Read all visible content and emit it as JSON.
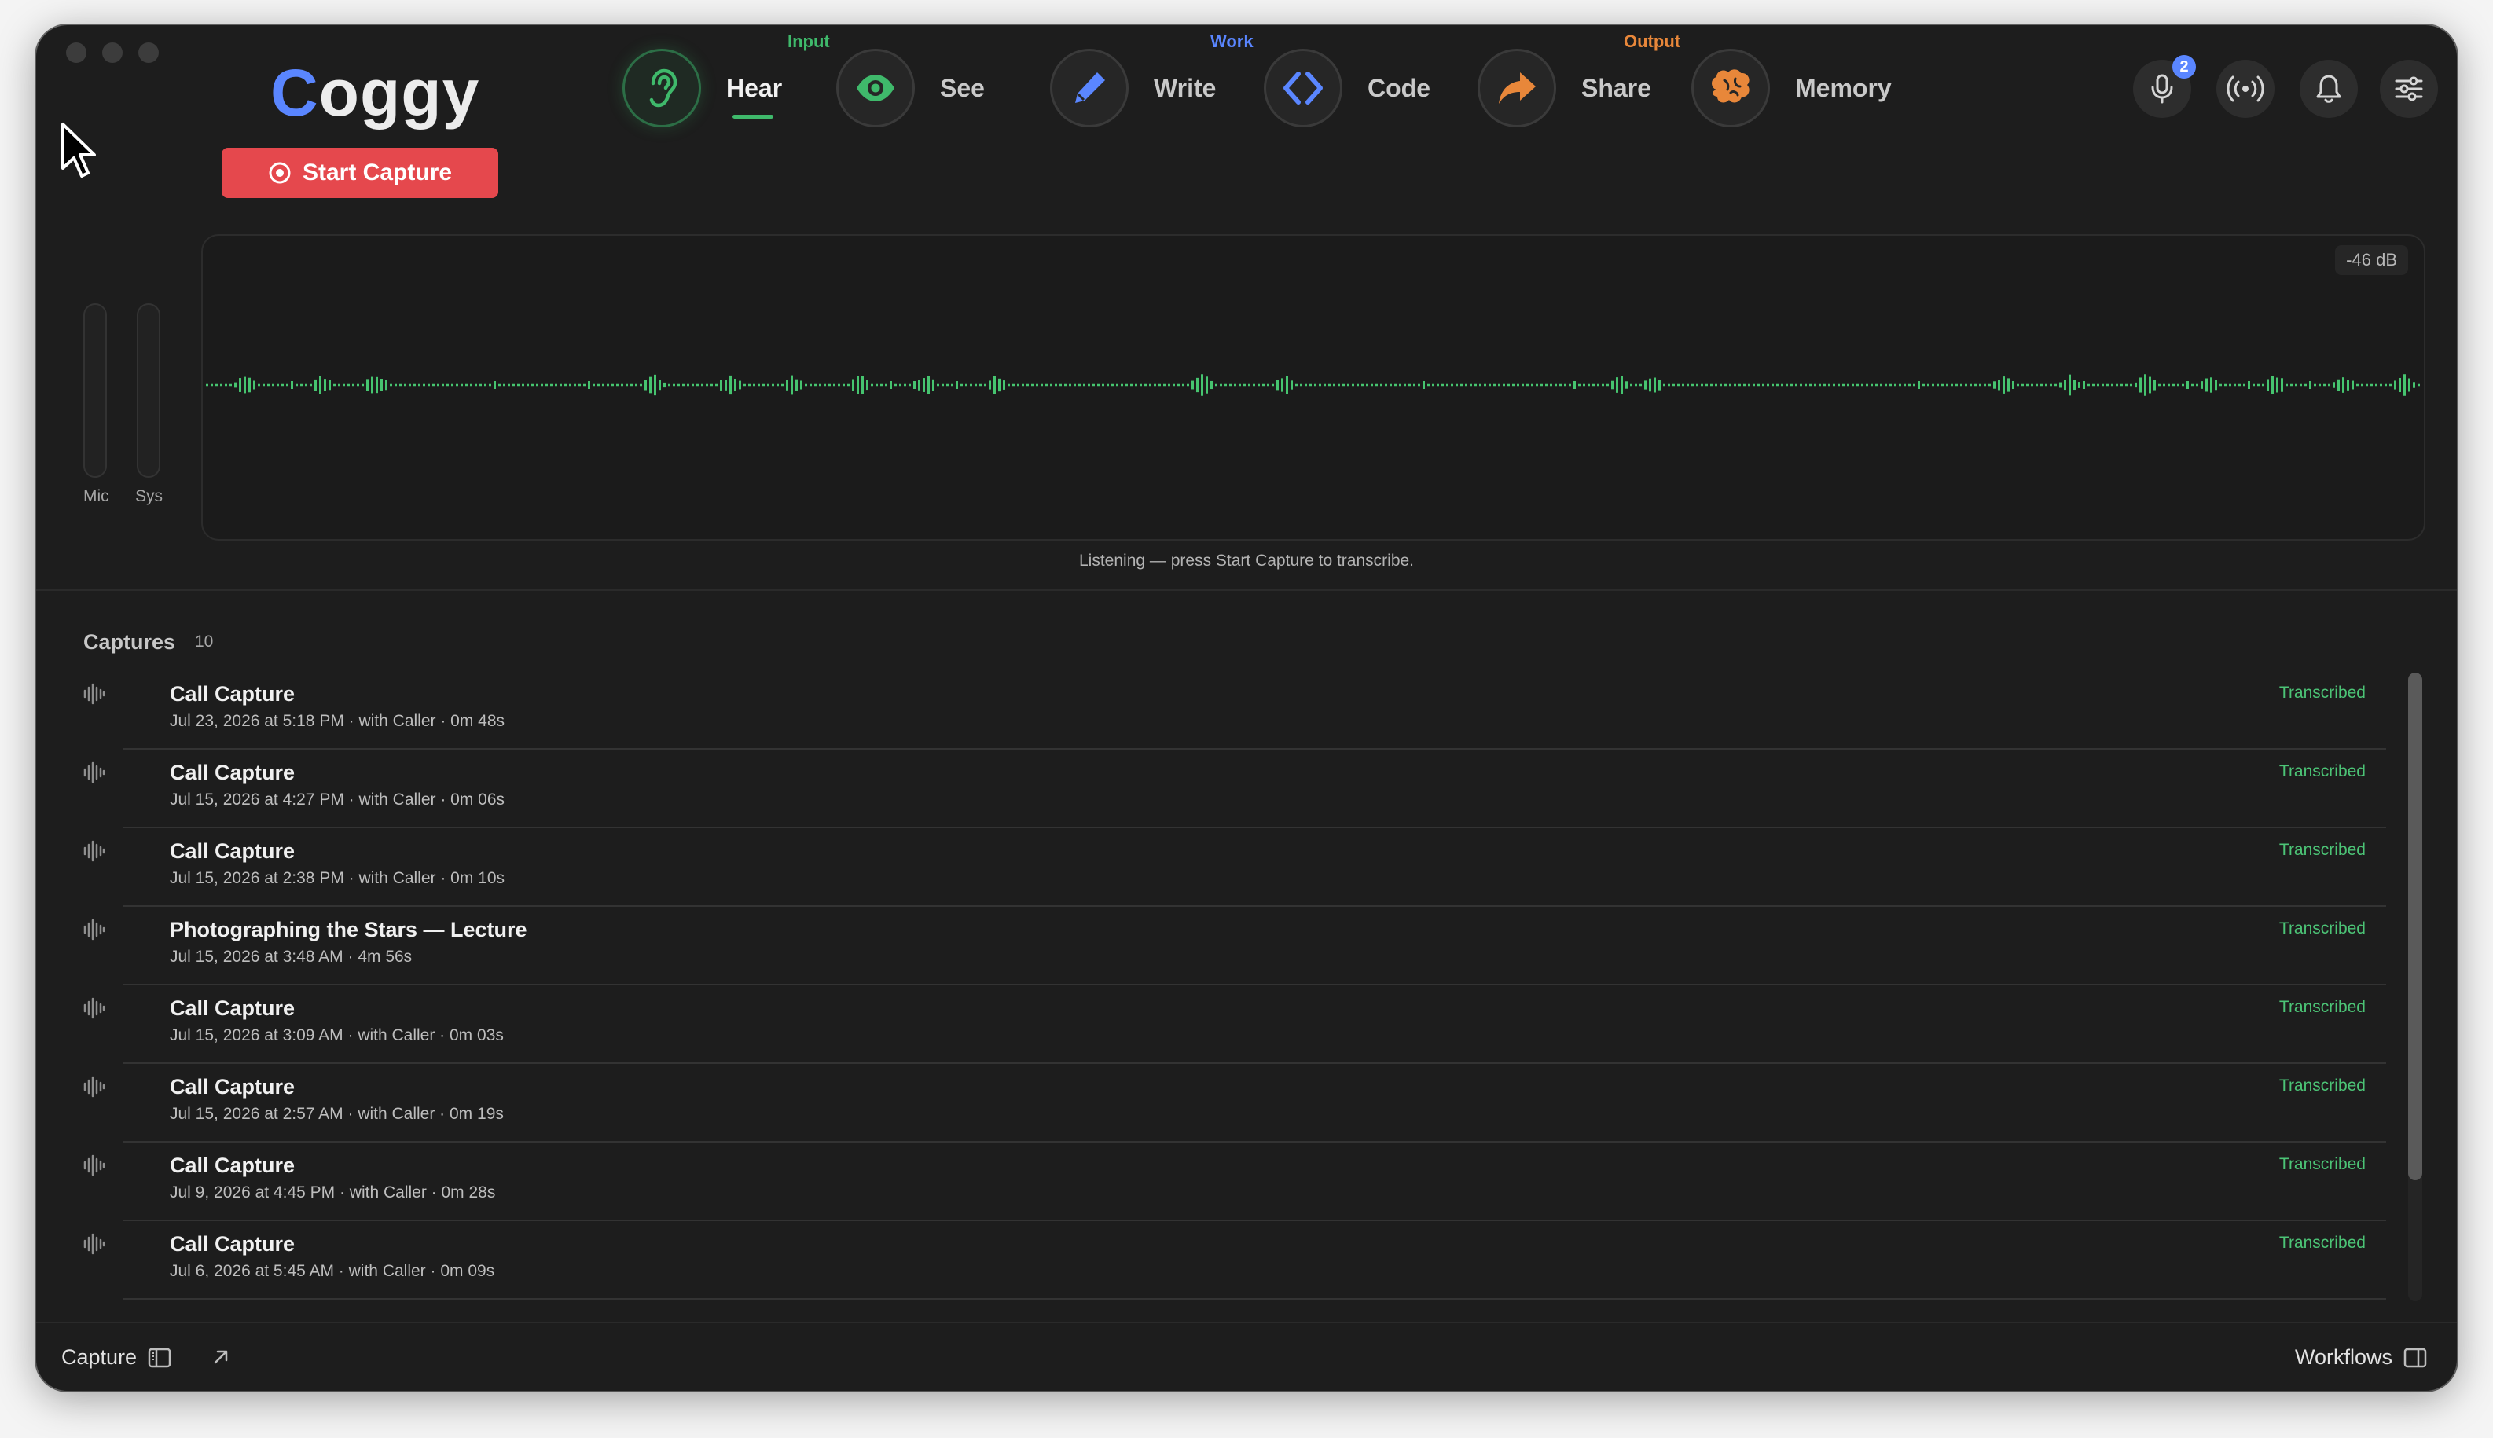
{
  "app": {
    "name_initial": "C",
    "name_rest": "oggy"
  },
  "capture_button_label": "Start Capture",
  "nav": {
    "groups": [
      {
        "label": "Input",
        "color": "#3fb96b"
      },
      {
        "label": "Work",
        "color": "#5a86ff"
      },
      {
        "label": "Output",
        "color": "#e8873a"
      }
    ],
    "items": [
      {
        "label": "Hear",
        "icon": "ear-icon",
        "active": true
      },
      {
        "label": "See",
        "icon": "eye-icon"
      },
      {
        "label": "Write",
        "icon": "pencil-icon"
      },
      {
        "label": "Code",
        "icon": "code-brackets-icon"
      },
      {
        "label": "Share",
        "icon": "share-arrow-icon"
      },
      {
        "label": "Memory",
        "icon": "brain-icon"
      }
    ]
  },
  "toolbar": {
    "mic_badge": "2"
  },
  "levels": {
    "mic_label": "Mic",
    "sys_label": "Sys"
  },
  "waveform": {
    "db_label": "-46 dB",
    "color": "#46c46f"
  },
  "listening_text": "Listening — press Start Capture to transcribe.",
  "captures": {
    "title": "Captures",
    "count": "10",
    "items": [
      {
        "title": "Call Capture",
        "meta": "Jul 23, 2026 at 5:18 PM · with Caller · 0m 48s",
        "status": "Transcribed"
      },
      {
        "title": "Call Capture",
        "meta": "Jul 15, 2026 at 4:27 PM · with Caller · 0m 06s",
        "status": "Transcribed"
      },
      {
        "title": "Call Capture",
        "meta": "Jul 15, 2026 at 2:38 PM · with Caller · 0m 10s",
        "status": "Transcribed"
      },
      {
        "title": "Photographing the Stars — Lecture",
        "meta": "Jul 15, 2026 at 3:48 AM · 4m 56s",
        "status": "Transcribed"
      },
      {
        "title": "Call Capture",
        "meta": "Jul 15, 2026 at 3:09 AM · with Caller · 0m 03s",
        "status": "Transcribed"
      },
      {
        "title": "Call Capture",
        "meta": "Jul 15, 2026 at 2:57 AM · with Caller · 0m 19s",
        "status": "Transcribed"
      },
      {
        "title": "Call Capture",
        "meta": "Jul 9, 2026 at 4:45 PM · with Caller · 0m 28s",
        "status": "Transcribed"
      },
      {
        "title": "Call Capture",
        "meta": "Jul 6, 2026 at 5:45 AM · with Caller · 0m 09s",
        "status": "Transcribed"
      }
    ]
  },
  "footer": {
    "left_label": "Capture",
    "right_label": "Workflows"
  }
}
